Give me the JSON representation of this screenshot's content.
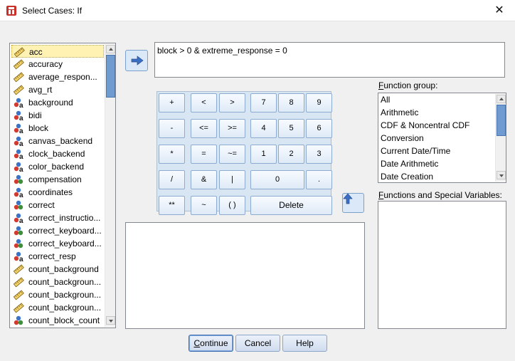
{
  "window": {
    "title": "Select Cases: If",
    "close_symbol": "✕"
  },
  "variables": [
    {
      "name": "acc",
      "icon": "scale-icon",
      "selected": true
    },
    {
      "name": "accuracy",
      "icon": "scale-icon"
    },
    {
      "name": "average_respon...",
      "icon": "scale-icon"
    },
    {
      "name": "avg_rt",
      "icon": "scale-icon"
    },
    {
      "name": "background",
      "icon": "nominal-string-icon"
    },
    {
      "name": "bidi",
      "icon": "nominal-string-icon"
    },
    {
      "name": "block",
      "icon": "nominal-string-icon"
    },
    {
      "name": "canvas_backend",
      "icon": "nominal-string-icon"
    },
    {
      "name": "clock_backend",
      "icon": "nominal-string-icon"
    },
    {
      "name": "color_backend",
      "icon": "nominal-string-icon"
    },
    {
      "name": "compensation",
      "icon": "nominal-icon"
    },
    {
      "name": "coordinates",
      "icon": "nominal-string-icon"
    },
    {
      "name": "correct",
      "icon": "nominal-icon"
    },
    {
      "name": "correct_instructio...",
      "icon": "nominal-string-icon"
    },
    {
      "name": "correct_keyboard...",
      "icon": "nominal-icon"
    },
    {
      "name": "correct_keyboard...",
      "icon": "nominal-icon"
    },
    {
      "name": "correct_resp",
      "icon": "nominal-string-icon"
    },
    {
      "name": "count_background",
      "icon": "scale-icon"
    },
    {
      "name": "count_backgroun...",
      "icon": "scale-icon"
    },
    {
      "name": "count_backgroun...",
      "icon": "scale-icon"
    },
    {
      "name": "count_backgroun...",
      "icon": "scale-icon"
    },
    {
      "name": "count_block_count",
      "icon": "nominal-icon"
    }
  ],
  "expression": "block > 0 & extreme_response = 0",
  "keypad": [
    "+",
    "<",
    ">",
    "7",
    "8",
    "9",
    "-",
    "<=",
    ">=",
    "4",
    "5",
    "6",
    "*",
    "=",
    "~=",
    "1",
    "2",
    "3",
    "/",
    "&",
    "|",
    "0",
    ".",
    "**",
    "~",
    "( )",
    "Delete"
  ],
  "function_group": {
    "label_pre": "",
    "label_u": "F",
    "label_post": "unction group:",
    "items": [
      "All",
      "Arithmetic",
      "CDF & Noncentral CDF",
      "Conversion",
      "Current Date/Time",
      "Date Arithmetic",
      "Date Creation"
    ]
  },
  "special_vars": {
    "label_pre": "",
    "label_u": "F",
    "label_post": "unctions and Special Variables:"
  },
  "buttons": {
    "continue_u": "C",
    "continue_rest": "ontinue",
    "cancel": "Cancel",
    "help": "Help"
  },
  "colors": {
    "selection_bg": "#fff2b3",
    "scroll_thumb": "#6f9bd0",
    "keypad_bg": "#d8e6f4"
  }
}
